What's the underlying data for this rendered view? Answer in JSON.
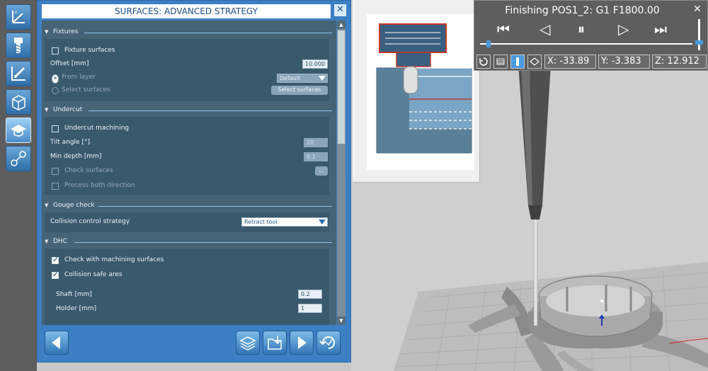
{
  "dialog": {
    "title": "SURFACES: ADVANCED STRATEGY",
    "close_glyph": "✕"
  },
  "sections": {
    "fixtures": {
      "heading": "Fixtures",
      "fixture_surfaces": {
        "label": "Fixture surfaces",
        "checked": false
      },
      "offset": {
        "label": "Offset [mm]",
        "value": "10.000"
      },
      "from_layer": {
        "label": "From layer",
        "selected": true,
        "enabled": false
      },
      "layer_select": {
        "value": "Default"
      },
      "select_surfaces_radio": {
        "label": "Select surfaces",
        "enabled": false
      },
      "select_surfaces_button": {
        "label": "Select surfaces"
      }
    },
    "undercut": {
      "heading": "Undercut",
      "undercut_machining": {
        "label": "Undercut machining",
        "checked": false
      },
      "tilt_angle": {
        "label": "Tilt angle [°]",
        "value": "20"
      },
      "min_depth": {
        "label": "Min depth [mm]",
        "value": "0.1"
      },
      "check_surfaces": {
        "label": "Check surfaces",
        "checked": false
      },
      "check_surfaces_button": "...",
      "process_both": {
        "label": "Process both direction",
        "checked": false
      }
    },
    "gouge_check": {
      "heading": "Gouge check",
      "collision_strategy": {
        "label": "Collision control strategy",
        "value": "Retract tool"
      }
    },
    "dhc": {
      "heading": "DHC",
      "check_machining": {
        "label": "Check with machining surfaces",
        "checked": true
      },
      "collision_safe": {
        "label": "Collision safe ares",
        "checked": true
      },
      "shaft": {
        "label": "Shaft [mm]",
        "value": "0.2"
      },
      "holder": {
        "label": "Holder [mm]",
        "value": "1"
      }
    }
  },
  "strip_icons": [
    "axis-icon",
    "tool-icon",
    "probe-icon",
    "stock-icon",
    "strategy-icon",
    "link-icon"
  ],
  "bottom_bar_icons": [
    "back-arrow-icon",
    "layers-icon",
    "export-icon",
    "play-icon",
    "regenerate-icon"
  ],
  "simulation": {
    "title": "Finishing POS1_2: G1 F1800.00",
    "close_glyph": "✕",
    "controls": [
      "⏮",
      "◁",
      "⏸",
      "▷",
      "⏭"
    ],
    "x": "X: -33.89",
    "y": "Y: -3.383",
    "z": "Z: 12.912",
    "progress": 0.03
  },
  "colors": {
    "dialog_blue": "#3d7fc4",
    "panel": "#466476",
    "accent": "#4a9ae0"
  }
}
